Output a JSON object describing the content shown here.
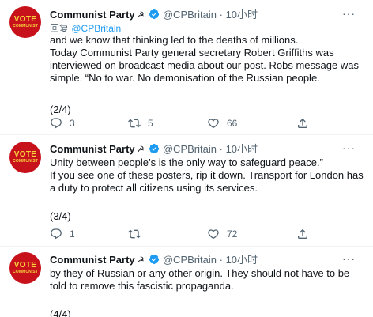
{
  "tweets": [
    {
      "author": {
        "name": "Communist Party",
        "emoji": "☭",
        "handle": "@CPBritain",
        "dot": "·",
        "time": "10小时",
        "avatar_text_top": "VOTE",
        "avatar_text_bottom": "COMMUNIST"
      },
      "replying_prefix": "回复",
      "replying_mention": "@CPBritain",
      "text": "and we know that thinking led to the deaths of millions.\nToday Communist Party general secretary Robert Griffiths was interviewed on broadcast media about our post. Robs message was simple. “No to war. No demonisation of the Russian people.",
      "counter": "(2/4)",
      "replies": "3",
      "retweets": "5",
      "likes": "66"
    },
    {
      "author": {
        "name": "Communist Party",
        "emoji": "☭",
        "handle": "@CPBritain",
        "dot": "·",
        "time": "10小时",
        "avatar_text_top": "VOTE",
        "avatar_text_bottom": "COMMUNIST"
      },
      "text": "Unity between people’s is the only way to safeguard peace.”\nIf you see one of these posters, rip it down. Transport for London has a duty to protect all citizens using its services.",
      "counter": "(3/4)",
      "replies": "1",
      "retweets": "",
      "likes": "72"
    },
    {
      "author": {
        "name": "Communist Party",
        "emoji": "☭",
        "handle": "@CPBritain",
        "dot": "·",
        "time": "10小时",
        "avatar_text_top": "VOTE",
        "avatar_text_bottom": "COMMUNIST"
      },
      "text": "by they of Russian or any other origin. They should not have to be told to remove this fascistic propaganda.",
      "counter": "(4/4)"
    }
  ],
  "icons": {
    "verified": "verified-badge-icon",
    "more": "more-options-icon",
    "reply": "reply-icon",
    "retweet": "retweet-icon",
    "like": "like-heart-icon",
    "share": "share-icon"
  },
  "colors": {
    "accent": "#1d9bf0",
    "secondary_text": "#536471",
    "avatar_red": "#c8121b",
    "avatar_yellow": "#f6d33d",
    "divider": "#eff3f4"
  }
}
